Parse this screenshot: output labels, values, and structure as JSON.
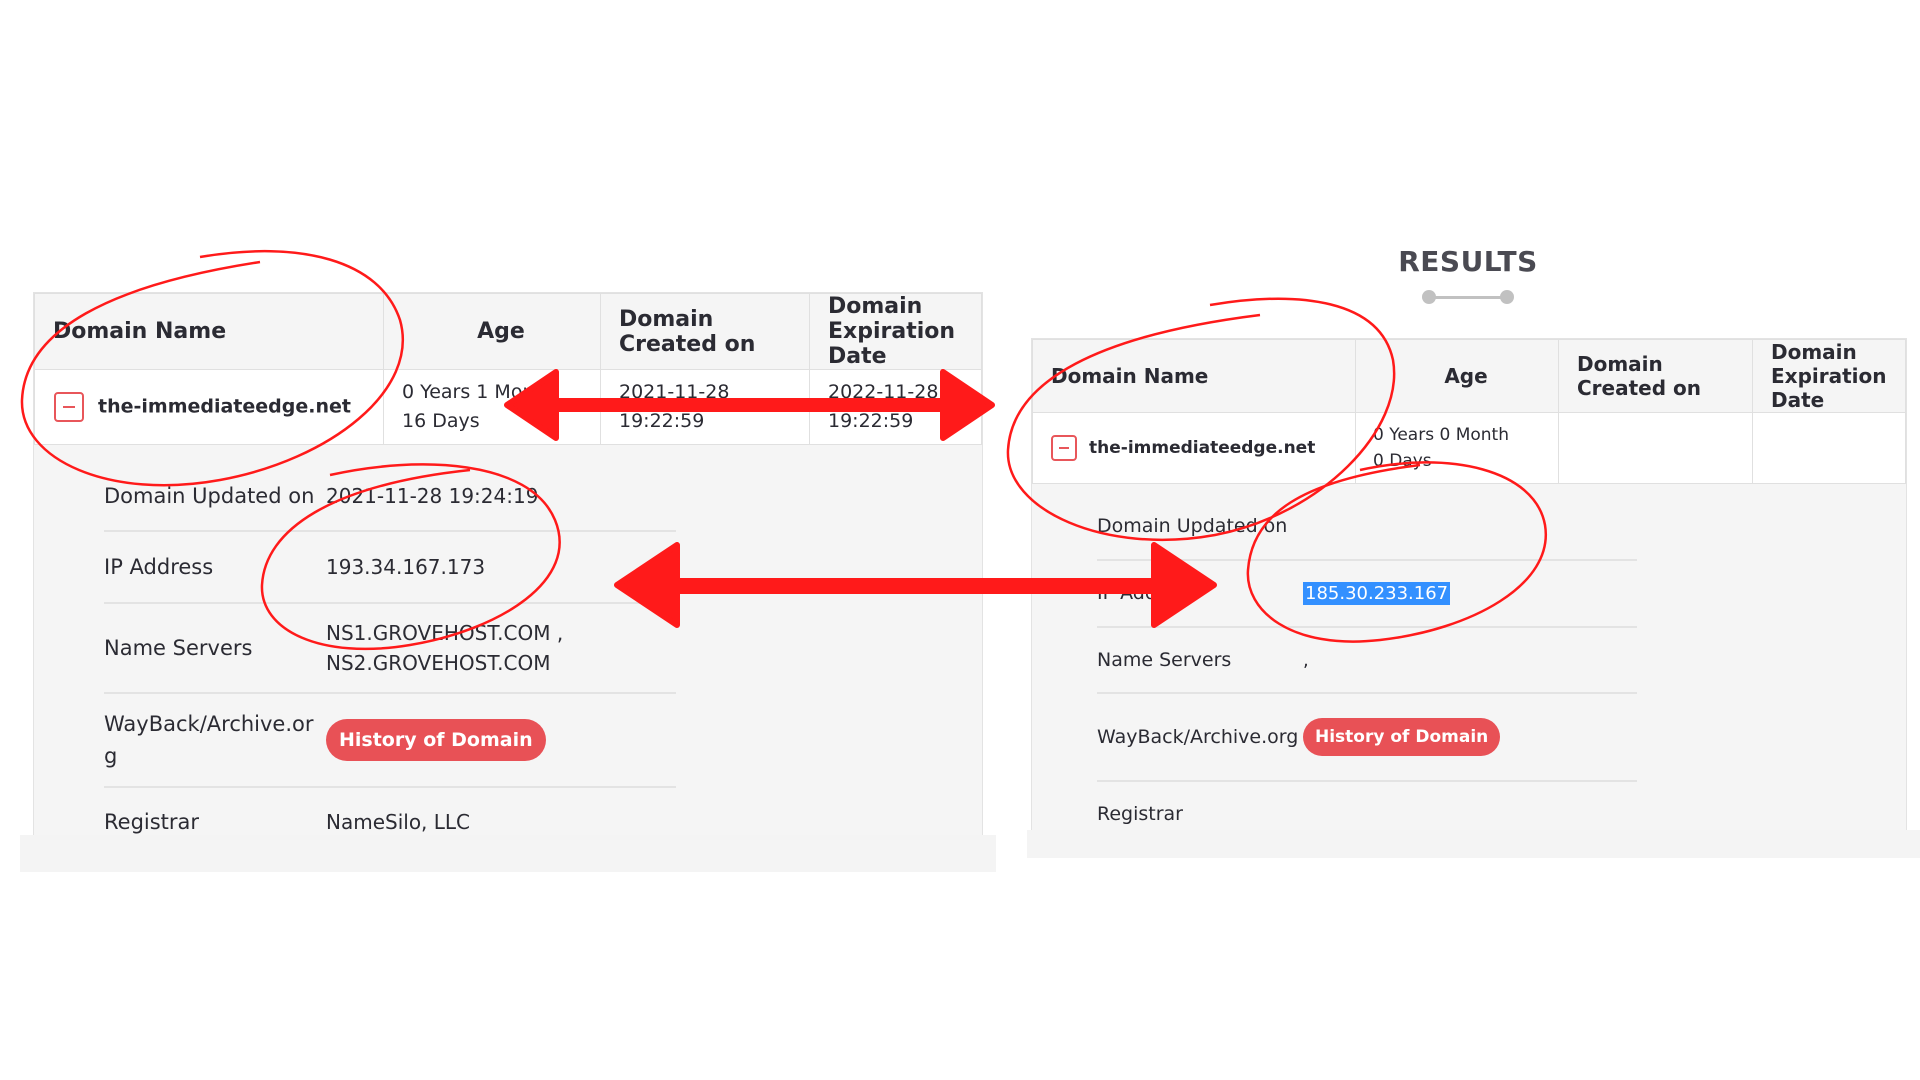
{
  "colors": {
    "annotation_red": "#ff1a1a",
    "button_red": "#e85156",
    "selection_blue": "#3390ff",
    "panel_bg": "#f5f5f5"
  },
  "left": {
    "table": {
      "headers": [
        "Domain Name",
        "Age",
        "Domain Created on",
        "Domain Expiration Date"
      ],
      "row": {
        "toggle_icon": "minus-square-icon",
        "domain_name": "the-immediateedge.net",
        "age_line1": "0 Years 1 Month",
        "age_line2": "16 Days",
        "created_line1": "2021-11-28",
        "created_line2": "19:22:59",
        "expiration_line1": "2022-11-28",
        "expiration_line2": "19:22:59"
      }
    },
    "details": {
      "updated_label": "Domain Updated on",
      "updated_value": "2021-11-28 19:24:19",
      "ip_label": "IP Address",
      "ip_value": "193.34.167.173",
      "ns_label": "Name Servers",
      "ns_value_line1": "NS1.GROVEHOST.COM ,",
      "ns_value_line2": "NS2.GROVEHOST.COM",
      "wayback_label": "WayBack/Archive.org",
      "history_button": "History of Domain",
      "registrar_label": "Registrar",
      "registrar_value": "NameSilo, LLC"
    }
  },
  "right": {
    "section_title": "RESULTS",
    "table": {
      "headers": [
        "Domain Name",
        "Age",
        "Domain Created on",
        "Domain Expiration Date"
      ],
      "row": {
        "toggle_icon": "minus-square-icon",
        "domain_name": "the-immediateedge.net",
        "age_line1": "0 Years 0 Month",
        "age_line2": "0 Days",
        "created": "",
        "expiration": ""
      }
    },
    "details": {
      "updated_label": "Domain Updated on",
      "updated_value": "",
      "ip_label": "IP Address",
      "ip_value": "185.30.233.167",
      "ns_label": "Name Servers",
      "ns_value": ",",
      "wayback_label": "WayBack/Archive.org",
      "history_button": "History of Domain",
      "registrar_label": "Registrar",
      "registrar_value": ""
    }
  },
  "annotations": {
    "circles": [
      "left-domain-name-circle",
      "left-ip-circle",
      "right-domain-name-circle",
      "right-ip-circle"
    ],
    "arrows": [
      "dates-double-arrow",
      "ip-double-arrow"
    ]
  }
}
